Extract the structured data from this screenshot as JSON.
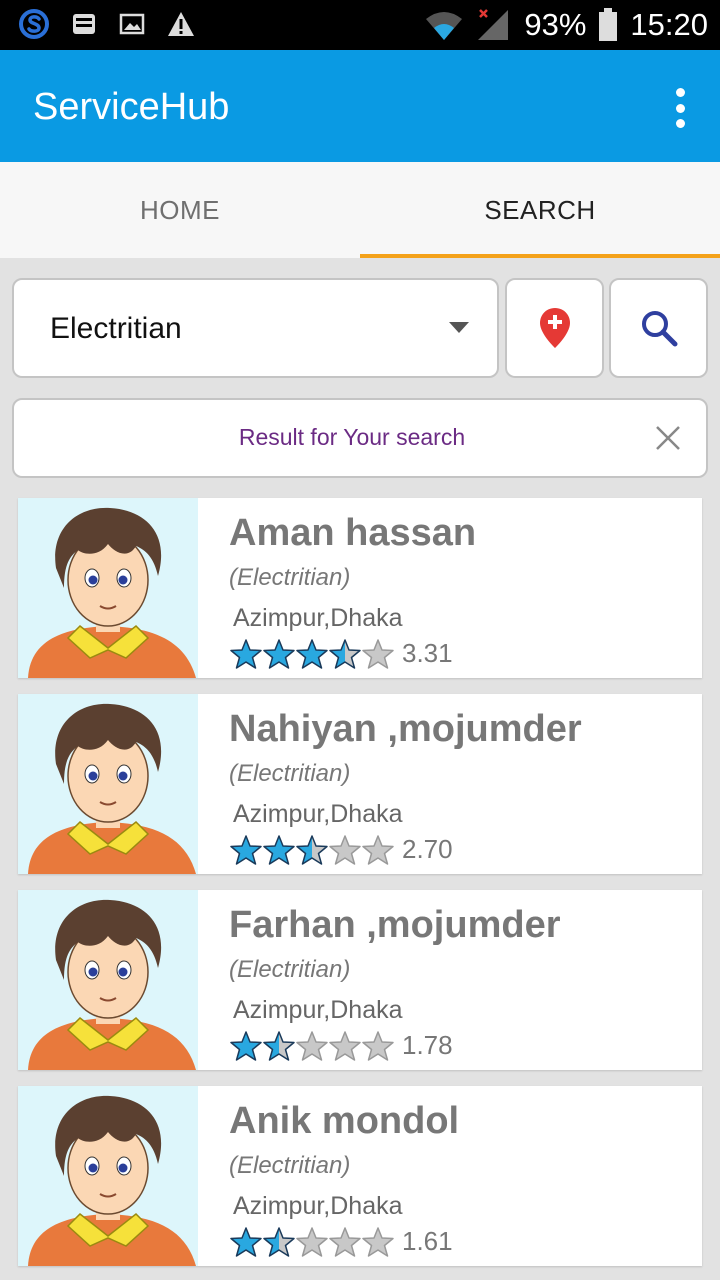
{
  "status_bar": {
    "battery": "93%",
    "time": "15:20"
  },
  "app_bar": {
    "title": "ServiceHub"
  },
  "tabs": [
    {
      "label": "HOME",
      "active": false
    },
    {
      "label": "SEARCH",
      "active": true
    }
  ],
  "search": {
    "category_selected": "Electritian",
    "location_icon": "location-pin-icon",
    "search_icon": "search-icon"
  },
  "result_banner": {
    "text": "Result for Your search"
  },
  "colors": {
    "app_bar": "#0a9ae3",
    "tab_indicator": "#f4a21a",
    "star_filled": "#29a8e0",
    "star_empty": "#c8c8c8",
    "result_text": "#6b2b84",
    "location_pin": "#e53935",
    "search_icon": "#2f3f9f"
  },
  "results": [
    {
      "name": "Aman hassan",
      "category": "(Electritian)",
      "location": "Azimpur,Dhaka",
      "rating": 3.31,
      "rating_label": "3.31"
    },
    {
      "name": "Nahiyan ,mojumder",
      "category": "(Electritian)",
      "location": "Azimpur,Dhaka",
      "rating": 2.7,
      "rating_label": "2.70"
    },
    {
      "name": "Farhan ,mojumder",
      "category": "(Electritian)",
      "location": "Azimpur,Dhaka",
      "rating": 1.78,
      "rating_label": "1.78"
    },
    {
      "name": "Anik mondol",
      "category": "(Electritian)",
      "location": "Azimpur,Dhaka",
      "rating": 1.61,
      "rating_label": "1.61"
    }
  ]
}
